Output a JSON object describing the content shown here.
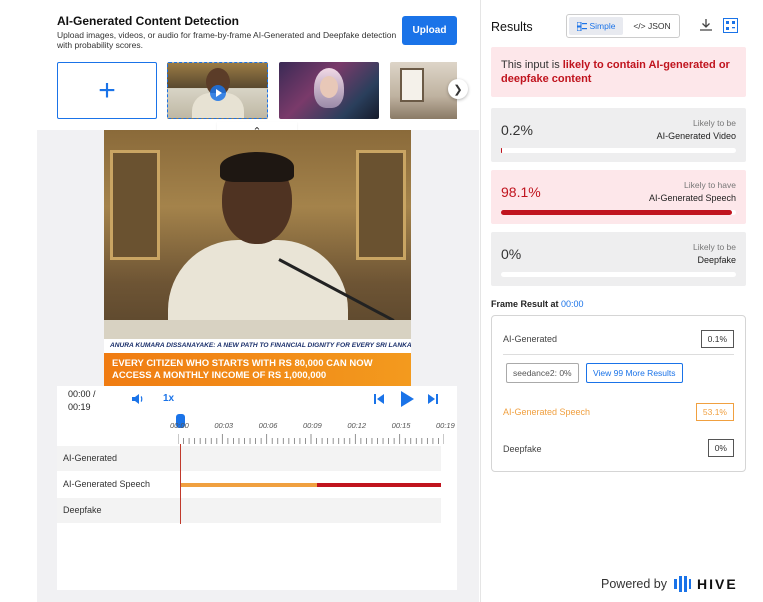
{
  "header": {
    "title": "AI-Generated Content Detection",
    "description": "Upload images, videos, or audio for frame-by-frame AI-Generated and Deepfake detection with probability scores.",
    "upload_label": "Upload"
  },
  "icons": {
    "add": "plus-icon",
    "next": "chevron-right-icon",
    "collapse": "chevron-up-icon"
  },
  "video": {
    "lower_third": "ANURA KUMARA DISSANAYAKE: A NEW PATH TO FINANCIAL DIGNITY FOR EVERY SRI LANKAN",
    "banner": "EVERY CITIZEN WHO STARTS WITH RS 80,000 CAN NOW ACCESS A MONTHLY INCOME OF RS 1,000,000"
  },
  "player": {
    "time_current": "00:00 /",
    "time_total": "00:19",
    "speed": "1x",
    "ticks": [
      "00:00",
      "00:03",
      "00:06",
      "00:09",
      "00:12",
      "00:15",
      "00:19"
    ],
    "tracks": [
      {
        "label": "AI-Generated"
      },
      {
        "label": "AI-Generated Speech"
      },
      {
        "label": "Deepfake"
      }
    ]
  },
  "results": {
    "title": "Results",
    "view_simple": "Simple",
    "view_json": "</> JSON",
    "alert_prefix": "This input is ",
    "alert_strong": "likely to contain AI-generated or deepfake content",
    "cards": [
      {
        "value": "0.2%",
        "line1": "Likely to be",
        "line2": "AI-Generated Video",
        "fill": 0.002
      },
      {
        "value": "98.1%",
        "line1": "Likely to have",
        "line2": "AI-Generated Speech",
        "fill": 0.981
      },
      {
        "value": "0%",
        "line1": "Likely to be",
        "line2": "Deepfake",
        "fill": 0
      }
    ],
    "frame_label": "Frame Result at ",
    "frame_time": "00:00",
    "frame_rows": {
      "ai_generated_label": "AI-Generated",
      "ai_generated_value": "0.1%",
      "chip_model": "seedance2: 0%",
      "chip_more": "View 99 More Results",
      "speech_label": "AI-Generated Speech",
      "speech_value": "53.1%",
      "deepfake_label": "Deepfake",
      "deepfake_value": "0%"
    },
    "powered_by": "Powered by",
    "brand": "HIVE"
  },
  "colors": {
    "accent": "#1a73e8",
    "danger": "#c0141e",
    "warning": "#f0a040"
  }
}
